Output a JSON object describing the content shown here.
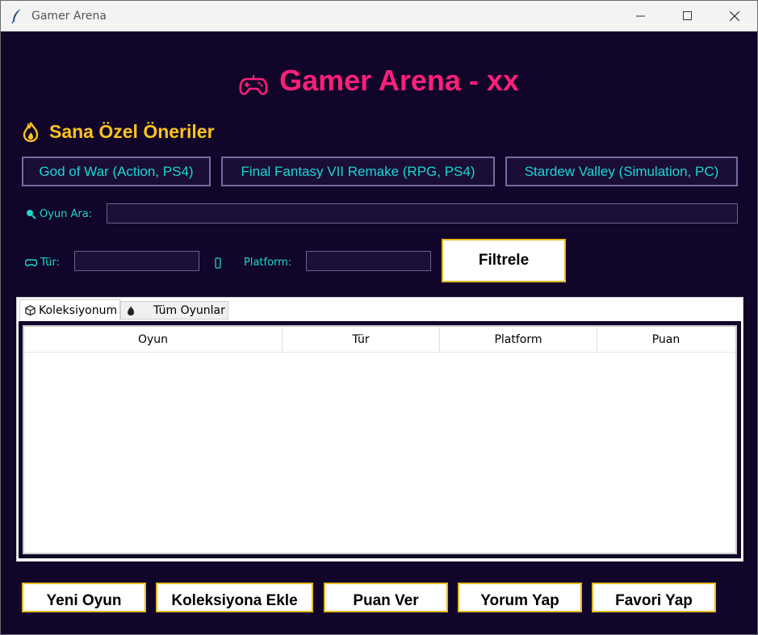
{
  "window": {
    "title": "Gamer Arena"
  },
  "header": {
    "title": "Gamer Arena - xx",
    "icon": "gamepad-icon"
  },
  "recommendations": {
    "heading": "Sana Özel Öneriler",
    "icon": "fire-icon",
    "items": [
      {
        "label": "God of War (Action, PS4)"
      },
      {
        "label": "Final Fantasy VII Remake (RPG, PS4)"
      },
      {
        "label": "Stardew Valley (Simulation, PC)"
      }
    ]
  },
  "search": {
    "label": "Oyun Ara:",
    "value": ""
  },
  "filters": {
    "genre_label": "Tür:",
    "genre_value": "",
    "platform_label": "Platform:",
    "platform_value": "",
    "filter_button": "Filtrele"
  },
  "tabs": [
    {
      "label": "Koleksiyonum",
      "icon": "box-icon",
      "active": true
    },
    {
      "label": "Tüm Oyunlar",
      "icon": "fire-icon",
      "active": false
    }
  ],
  "table": {
    "columns": [
      "Oyun",
      "Tür",
      "Platform",
      "Puan"
    ],
    "rows": []
  },
  "actions": [
    {
      "label": "Yeni Oyun"
    },
    {
      "label": "Koleksiyona Ekle"
    },
    {
      "label": "Puan Ver"
    },
    {
      "label": "Yorum Yap"
    },
    {
      "label": "Favori Yap"
    }
  ],
  "colors": {
    "background": "#11052a",
    "title": "#ff1f7a",
    "heading": "#ffc31a",
    "accent_text": "#18d8d0",
    "button_border": "#e5b820"
  }
}
